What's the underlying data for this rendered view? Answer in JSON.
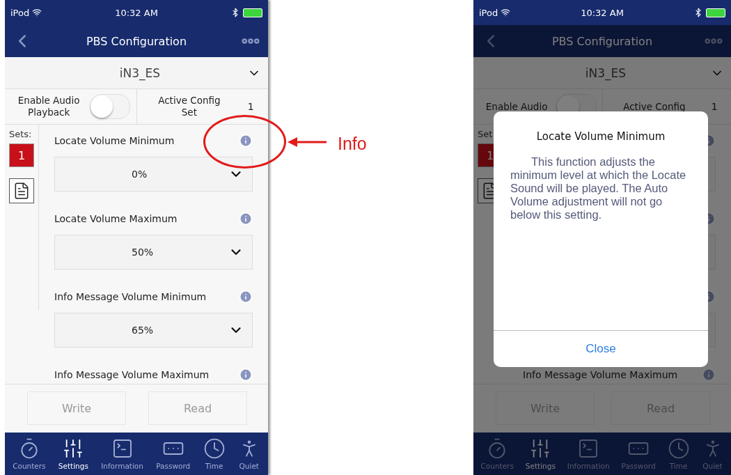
{
  "annotation": {
    "label": "Info"
  },
  "screens": [
    {
      "status_bar": {
        "carrier": "iPod",
        "time": "10:32 AM"
      },
      "nav": {
        "title": "PBS Configuration"
      },
      "device": {
        "value": "iN3_ES"
      },
      "audio_playback": {
        "label": "Enable Audio Playback",
        "on": false
      },
      "active_config": {
        "label": "Active Config Set",
        "value": "1"
      },
      "sets": {
        "label": "Sets:",
        "items": [
          {
            "label": "1",
            "selected": true
          }
        ]
      },
      "settings": [
        {
          "kind": "field",
          "label": "Locate Volume Minimum",
          "value": "0%"
        },
        {
          "kind": "field",
          "label": "Locate Volume Maximum",
          "value": "50%"
        },
        {
          "kind": "field",
          "label": "Info Message Volume Minimum",
          "value": "65%"
        },
        {
          "kind": "field",
          "label": "Info Message Volume Maximum"
        }
      ],
      "buttons": [
        {
          "label": "Write",
          "disabled": true
        },
        {
          "label": "Read",
          "disabled": true
        }
      ],
      "tabs": [
        {
          "kind": "counters",
          "label": "Counters",
          "selected": false
        },
        {
          "kind": "settings",
          "label": "Settings",
          "selected": true
        },
        {
          "kind": "information",
          "label": "Information",
          "selected": false
        },
        {
          "kind": "password",
          "label": "Password",
          "selected": false
        },
        {
          "kind": "time",
          "label": "Time",
          "selected": false
        },
        {
          "kind": "quiet",
          "label": "Quiet",
          "selected": false
        }
      ]
    },
    {
      "status_bar": {
        "carrier": "iPod",
        "time": "10:32 AM"
      },
      "nav": {
        "title": "PBS Configuration"
      },
      "device": {
        "value": "iN3_ES"
      },
      "audio_playback": {
        "label": "Enable Audio",
        "on": false
      },
      "active_config": {
        "label": "Active Config",
        "value": "1"
      },
      "sets": {
        "label": "Set",
        "items": [
          {
            "label": "1",
            "selected": true
          }
        ]
      },
      "settings": [
        {
          "kind": "covered"
        },
        {
          "kind": "covered"
        },
        {
          "kind": "covered"
        },
        {
          "kind": "field",
          "label": "Info Message Volume Maximum"
        }
      ],
      "buttons": [
        {
          "label": "Write",
          "disabled": true
        },
        {
          "label": "Read",
          "disabled": true
        }
      ],
      "tabs": [
        {
          "kind": "counters",
          "label": "Counters",
          "selected": false
        },
        {
          "kind": "settings",
          "label": "Settings",
          "selected": true
        },
        {
          "kind": "information",
          "label": "Information",
          "selected": false
        },
        {
          "kind": "password",
          "label": "Password",
          "selected": false
        },
        {
          "kind": "time",
          "label": "Time",
          "selected": false
        },
        {
          "kind": "quiet",
          "label": "Quiet",
          "selected": false
        }
      ],
      "dialog": {
        "title": "Locate Volume Minimum",
        "body": "This function adjusts the minimum level at which the Locate Sound will be played. The Auto Volume adjustment will not go below this setting.",
        "button": "Close"
      }
    }
  ]
}
